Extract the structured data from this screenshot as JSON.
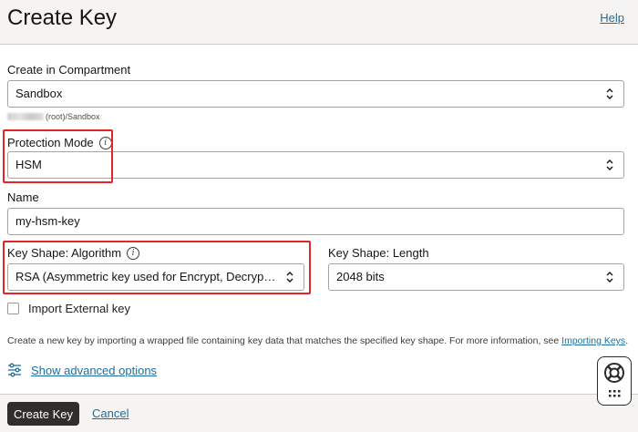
{
  "header": {
    "title": "Create Key",
    "help_label": "Help"
  },
  "compartment": {
    "label": "Create in Compartment",
    "value": "Sandbox",
    "path_hint": "(root)/Sandbox"
  },
  "protection_mode": {
    "label": "Protection Mode",
    "value": "HSM"
  },
  "name": {
    "label": "Name",
    "value": "my-hsm-key"
  },
  "key_shape_algorithm": {
    "label": "Key Shape: Algorithm",
    "value": "RSA (Asymmetric key used for Encrypt, Decrypt, Sig..."
  },
  "key_shape_length": {
    "label": "Key Shape: Length",
    "value": "2048 bits"
  },
  "import_external": {
    "label": "Import External key",
    "checked": false
  },
  "description": {
    "text": "Create a new key by importing a wrapped file containing key data that matches the specified key shape. For more information, see ",
    "link": "Importing Keys",
    "suffix": "."
  },
  "advanced": {
    "label": "Show advanced options"
  },
  "footer": {
    "primary_label": "Create Key",
    "cancel_label": "Cancel"
  },
  "icons": {
    "info": "info-icon",
    "select_arrows": "chevron-updown-icon",
    "advanced": "sliders-icon",
    "help_widget": "lifebuoy-icon",
    "grid": "grid-dots-icon"
  },
  "colors": {
    "accent_link": "#1f6e9c",
    "primary_button": "#312d2a",
    "highlight": "#e3262a"
  }
}
